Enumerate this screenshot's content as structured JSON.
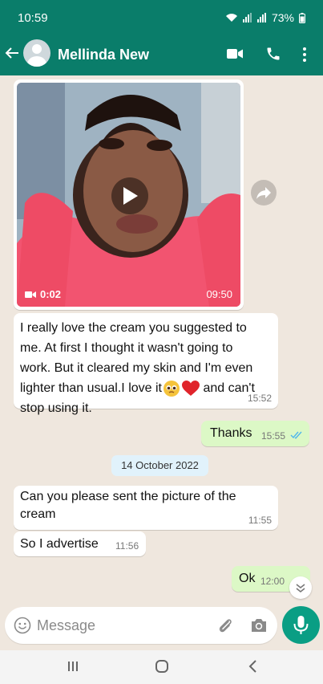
{
  "status_bar": {
    "time": "10:59",
    "battery": "73%"
  },
  "header": {
    "contact_name": "Mellinda New"
  },
  "messages": [
    {
      "type": "video",
      "direction": "incoming",
      "duration": "0:02",
      "time": "09:50"
    },
    {
      "type": "text",
      "direction": "incoming",
      "lines": [
        "I really love the cream you suggested to",
        "me. At first I thought it wasn't going to",
        "work. But it cleared my skin and I'm even",
        "lighter than usual.I love it",
        " and can't",
        "stop using it."
      ],
      "time": "15:52"
    },
    {
      "type": "text",
      "direction": "outgoing",
      "text": "Thanks",
      "time": "15:55"
    },
    {
      "type": "date",
      "text": "14 October 2022"
    },
    {
      "type": "text",
      "direction": "incoming",
      "lines": [
        "Can you please sent the picture of the",
        "cream"
      ],
      "time": "11:55"
    },
    {
      "type": "text",
      "direction": "incoming",
      "text": "So I advertise",
      "time": "11:56"
    },
    {
      "type": "text",
      "direction": "outgoing",
      "text": "Ok",
      "time": "12:00"
    }
  ],
  "composer": {
    "placeholder": "Message"
  },
  "colors": {
    "header": "#0a7d6a",
    "chat_bg": "#efe7de",
    "outgoing_bubble": "#dcf8c6",
    "incoming_bubble": "#ffffff",
    "mic_button": "#0a9e84",
    "read_ticks": "#4fb6ec"
  }
}
